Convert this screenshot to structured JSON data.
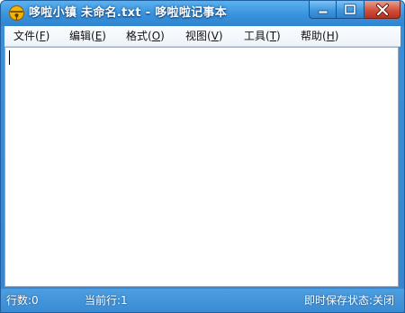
{
  "window": {
    "title": "哆啦小镇 未命名.txt - 哆啦啦记事本",
    "icon": "doraemon-bell-icon"
  },
  "caption_buttons": {
    "minimize": "minimize-icon",
    "maximize": "maximize-icon",
    "close": "close-icon"
  },
  "menu": [
    {
      "label": "文件(",
      "key": "F",
      "end": ")"
    },
    {
      "label": "编辑(",
      "key": "E",
      "end": ")"
    },
    {
      "label": "格式(",
      "key": "O",
      "end": ")"
    },
    {
      "label": "视图(",
      "key": "V",
      "end": ")"
    },
    {
      "label": "工具(",
      "key": "T",
      "end": ")"
    },
    {
      "label": "帮助(",
      "key": "H",
      "end": ")"
    }
  ],
  "editor": {
    "content": ""
  },
  "status": {
    "line_count": "行数:0",
    "current_line": "当前行:1",
    "autosave": "即时保存状态:关闭"
  },
  "colors": {
    "titlebar": "#3a92dc",
    "statusbar": "#3a8ad2",
    "close_button": "#d0503c"
  }
}
